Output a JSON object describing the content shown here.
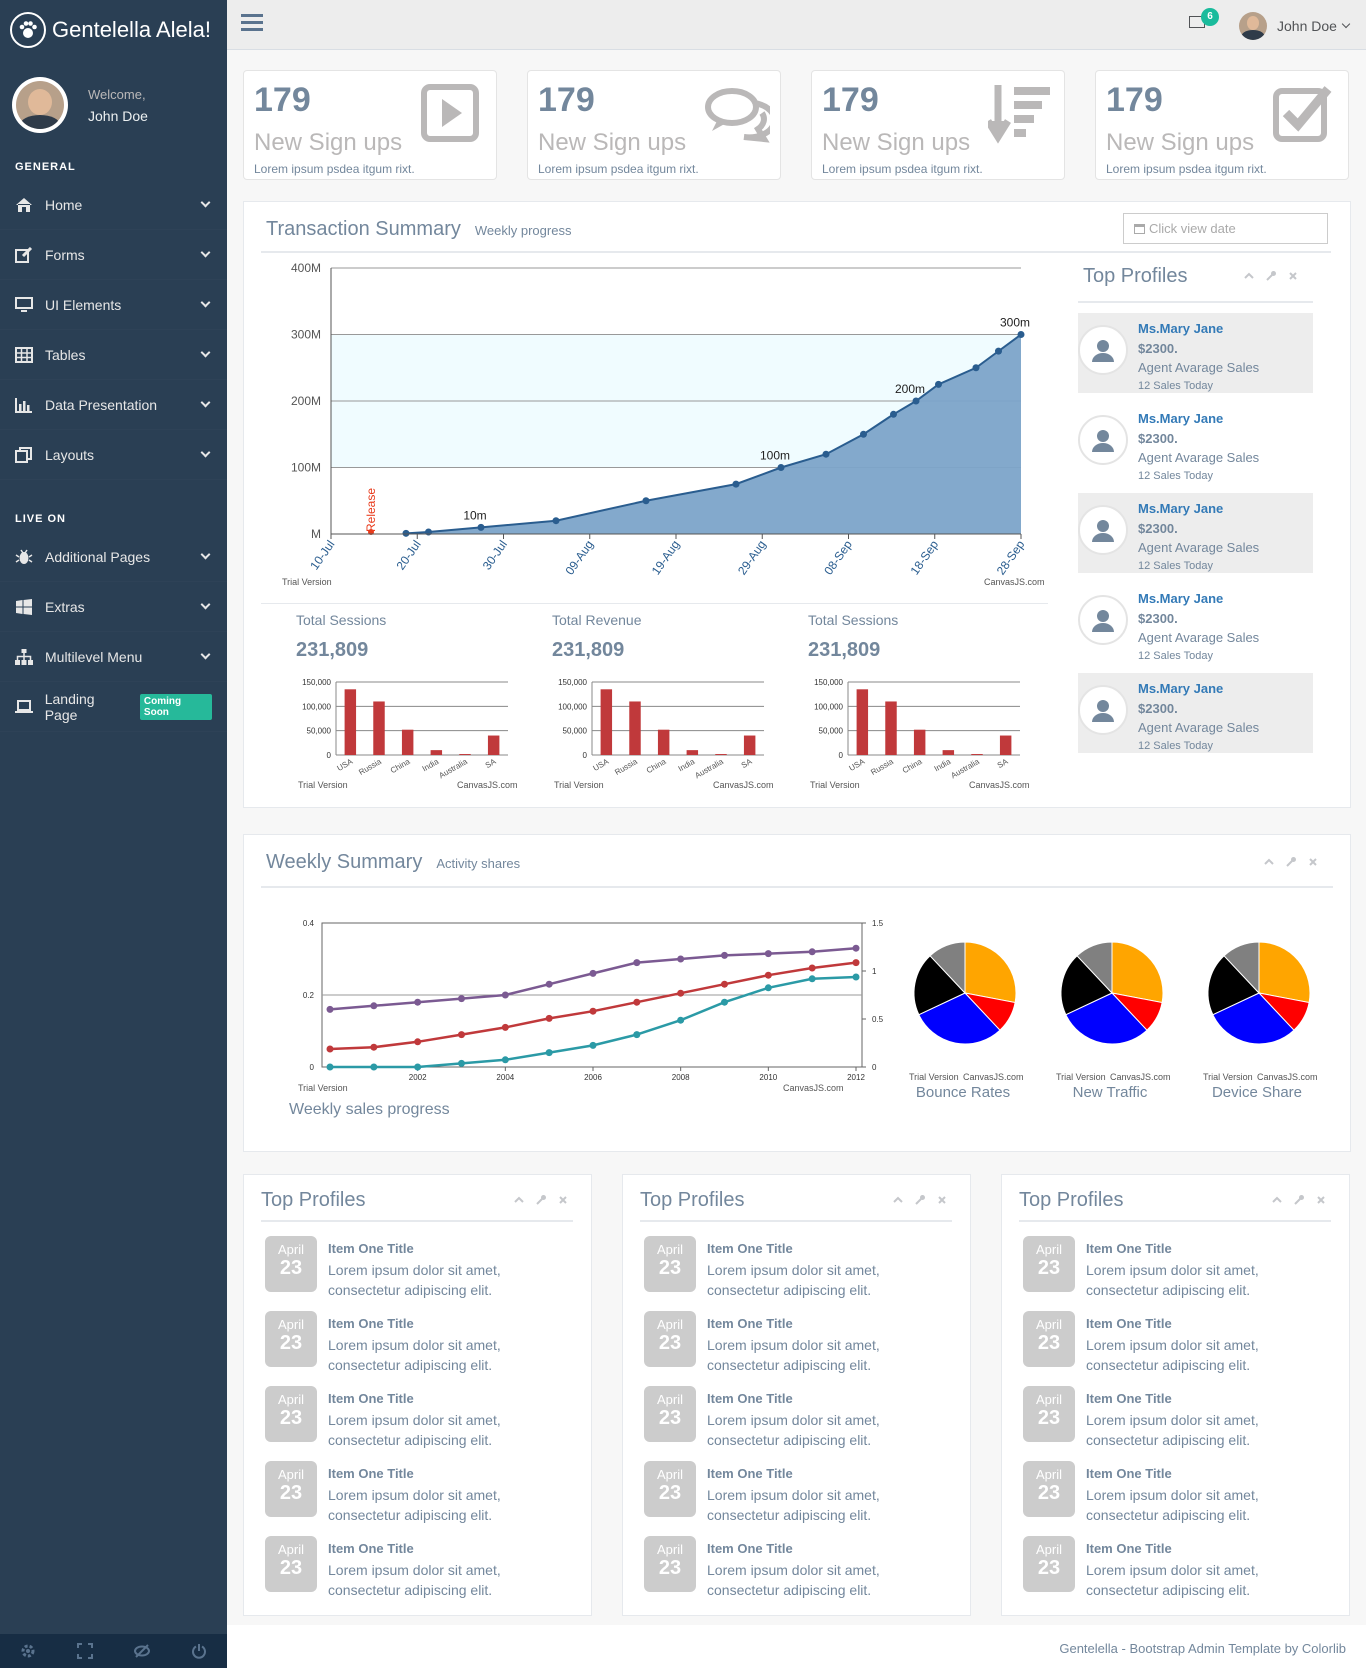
{
  "brand": {
    "title": "Gentelella Alela!"
  },
  "profile": {
    "welcome": "Welcome,",
    "name": "John Doe"
  },
  "sidebar": {
    "general_title": "GENERAL",
    "general_items": [
      {
        "label": "Home",
        "icon": "home-icon"
      },
      {
        "label": "Forms",
        "icon": "edit-icon"
      },
      {
        "label": "UI Elements",
        "icon": "desktop-icon"
      },
      {
        "label": "Tables",
        "icon": "table-icon"
      },
      {
        "label": "Data Presentation",
        "icon": "bar-chart-icon"
      },
      {
        "label": "Layouts",
        "icon": "clone-icon"
      }
    ],
    "live_title": "LIVE ON",
    "live_items": [
      {
        "label": "Additional Pages",
        "icon": "bug-icon"
      },
      {
        "label": "Extras",
        "icon": "windows-icon"
      },
      {
        "label": "Multilevel Menu",
        "icon": "sitemap-icon"
      },
      {
        "label": "Landing Page",
        "icon": "laptop-icon",
        "badge": "Coming Soon"
      }
    ]
  },
  "topnav": {
    "notifications": "6",
    "user": "John Doe"
  },
  "tiles": [
    {
      "count": "179",
      "title": "New Sign ups",
      "text": "Lorem ipsum psdea itgum rixt.",
      "icon": "caret-square-icon"
    },
    {
      "count": "179",
      "title": "New Sign ups",
      "text": "Lorem ipsum psdea itgum rixt.",
      "icon": "comments-icon"
    },
    {
      "count": "179",
      "title": "New Sign ups",
      "text": "Lorem ipsum psdea itgum rixt.",
      "icon": "sort-amount-icon"
    },
    {
      "count": "179",
      "title": "New Sign ups",
      "text": "Lorem ipsum psdea itgum rixt.",
      "icon": "check-square-icon"
    }
  ],
  "transaction": {
    "title": "Transaction Summary",
    "subtitle": "Weekly progress",
    "date_placeholder": "Click view date",
    "trial": "Trial Version",
    "credit": "CanvasJS.com",
    "minis": [
      {
        "title": "Total Sessions",
        "value": "231,809"
      },
      {
        "title": "Total Revenue",
        "value": "231,809"
      },
      {
        "title": "Total Sessions",
        "value": "231,809"
      }
    ]
  },
  "top_profiles_side": {
    "title": "Top Profiles",
    "items": [
      {
        "name": "Ms.Mary Jane",
        "value": "$2300.",
        "desc": "Agent Avarage Sales",
        "sales": "12 Sales Today"
      },
      {
        "name": "Ms.Mary Jane",
        "value": "$2300.",
        "desc": "Agent Avarage Sales",
        "sales": "12 Sales Today"
      },
      {
        "name": "Ms.Mary Jane",
        "value": "$2300.",
        "desc": "Agent Avarage Sales",
        "sales": "12 Sales Today"
      },
      {
        "name": "Ms.Mary Jane",
        "value": "$2300.",
        "desc": "Agent Avarage Sales",
        "sales": "12 Sales Today"
      },
      {
        "name": "Ms.Mary Jane",
        "value": "$2300.",
        "desc": "Agent Avarage Sales",
        "sales": "12 Sales Today"
      }
    ]
  },
  "weekly": {
    "title": "Weekly Summary",
    "subtitle": "Activity shares",
    "caption": "Weekly sales progress",
    "pies": [
      "Bounce Rates",
      "New Traffic",
      "Device Share"
    ]
  },
  "event_panels": [
    {
      "title": "Top Profiles",
      "items": [
        {
          "month": "April",
          "day": "23",
          "title": "Item One Title",
          "text": "Lorem ipsum dolor sit amet, consectetur adipiscing elit."
        },
        {
          "month": "April",
          "day": "23",
          "title": "Item One Title",
          "text": "Lorem ipsum dolor sit amet, consectetur adipiscing elit."
        },
        {
          "month": "April",
          "day": "23",
          "title": "Item One Title",
          "text": "Lorem ipsum dolor sit amet, consectetur adipiscing elit."
        },
        {
          "month": "April",
          "day": "23",
          "title": "Item One Title",
          "text": "Lorem ipsum dolor sit amet, consectetur adipiscing elit."
        },
        {
          "month": "April",
          "day": "23",
          "title": "Item One Title",
          "text": "Lorem ipsum dolor sit amet, consectetur adipiscing elit."
        }
      ]
    },
    {
      "title": "Top Profiles",
      "items": [
        {
          "month": "April",
          "day": "23",
          "title": "Item One Title",
          "text": "Lorem ipsum dolor sit amet, consectetur adipiscing elit."
        },
        {
          "month": "April",
          "day": "23",
          "title": "Item One Title",
          "text": "Lorem ipsum dolor sit amet, consectetur adipiscing elit."
        },
        {
          "month": "April",
          "day": "23",
          "title": "Item One Title",
          "text": "Lorem ipsum dolor sit amet, consectetur adipiscing elit."
        },
        {
          "month": "April",
          "day": "23",
          "title": "Item One Title",
          "text": "Lorem ipsum dolor sit amet, consectetur adipiscing elit."
        },
        {
          "month": "April",
          "day": "23",
          "title": "Item One Title",
          "text": "Lorem ipsum dolor sit amet, consectetur adipiscing elit."
        }
      ]
    },
    {
      "title": "Top Profiles",
      "items": [
        {
          "month": "April",
          "day": "23",
          "title": "Item One Title",
          "text": "Lorem ipsum dolor sit amet, consectetur adipiscing elit."
        },
        {
          "month": "April",
          "day": "23",
          "title": "Item One Title",
          "text": "Lorem ipsum dolor sit amet, consectetur adipiscing elit."
        },
        {
          "month": "April",
          "day": "23",
          "title": "Item One Title",
          "text": "Lorem ipsum dolor sit amet, consectetur adipiscing elit."
        },
        {
          "month": "April",
          "day": "23",
          "title": "Item One Title",
          "text": "Lorem ipsum dolor sit amet, consectetur adipiscing elit."
        },
        {
          "month": "April",
          "day": "23",
          "title": "Item One Title",
          "text": "Lorem ipsum dolor sit amet, consectetur adipiscing elit."
        }
      ]
    }
  ],
  "footer": {
    "text": "Gentelella - Bootstrap Admin Template by Colorlib"
  },
  "colors": {
    "sidebar": "#2a3f54",
    "accent": "#1abb9c",
    "area": "#7ca4c9",
    "bar": "#c0393b"
  },
  "chart_data": [
    {
      "type": "area",
      "x": [
        "10-Jul",
        "20-Jul",
        "30-Jul",
        "09-Aug",
        "19-Aug",
        "29-Aug",
        "08-Sep",
        "18-Sep",
        "28-Sep"
      ],
      "points": [
        {
          "x": "2015-07-20",
          "y": 1
        },
        {
          "x": "2015-07-23",
          "y": 3
        },
        {
          "x": "2015-07-30",
          "y": 10
        },
        {
          "x": "2015-08-09",
          "y": 20
        },
        {
          "x": "2015-08-21",
          "y": 50
        },
        {
          "x": "2015-09-02",
          "y": 75
        },
        {
          "x": "2015-09-08",
          "y": 100
        },
        {
          "x": "2015-09-14",
          "y": 120
        },
        {
          "x": "2015-09-19",
          "y": 150
        },
        {
          "x": "2015-09-23",
          "y": 180
        },
        {
          "x": "2015-09-26",
          "y": 200
        },
        {
          "x": "2015-09-29",
          "y": 225
        },
        {
          "x": "2015-10-04",
          "y": 250
        },
        {
          "x": "2015-10-07",
          "y": 275
        },
        {
          "x": "2015-10-10",
          "y": 300
        }
      ],
      "point_labels": [
        {
          "x": "2015-07-30",
          "text": "10m"
        },
        {
          "x": "2015-09-08",
          "text": "100m"
        },
        {
          "x": "2015-09-26",
          "text": "200m"
        },
        {
          "x": "2015-10-10",
          "text": "300m"
        }
      ],
      "y_ticks": [
        "M",
        "100M",
        "200M",
        "300M",
        "400M"
      ],
      "ylim": [
        0,
        400
      ],
      "band": [
        100,
        300
      ],
      "release_label": "Release"
    },
    {
      "type": "bar",
      "categories": [
        "USA",
        "Russia",
        "China",
        "India",
        "Australia",
        "SA"
      ],
      "values": [
        135000,
        110000,
        52000,
        10000,
        2000,
        40000
      ],
      "y_ticks": [
        "150,000",
        "100,000",
        "50,000",
        "0"
      ],
      "ylim": [
        0,
        150000
      ]
    },
    {
      "type": "line",
      "x": [
        2000,
        2001,
        2002,
        2003,
        2004,
        2005,
        2006,
        2007,
        2008,
        2009,
        2010,
        2011,
        2012
      ],
      "x_ticks": [
        "2002",
        "2004",
        "2006",
        "2008",
        "2010",
        "2012"
      ],
      "y_ticks_left": [
        "0.4",
        "0.2",
        "0"
      ],
      "y_ticks_right": [
        "1.5",
        "1",
        "0.5",
        "0"
      ],
      "series": [
        {
          "color": "#7b5a92",
          "values": [
            0.16,
            0.17,
            0.18,
            0.19,
            0.2,
            0.23,
            0.26,
            0.29,
            0.3,
            0.31,
            0.315,
            0.32,
            0.33
          ]
        },
        {
          "color": "#c0393b",
          "values": [
            0.05,
            0.055,
            0.07,
            0.09,
            0.11,
            0.135,
            0.155,
            0.18,
            0.205,
            0.23,
            0.255,
            0.275,
            0.29
          ]
        },
        {
          "color": "#2b9aa6",
          "values": [
            0.0,
            0.0,
            0.0,
            0.01,
            0.02,
            0.04,
            0.06,
            0.09,
            0.13,
            0.18,
            0.22,
            0.245,
            0.25
          ]
        }
      ]
    },
    {
      "type": "pie",
      "slices": [
        {
          "color": "#ffa500",
          "value": 28
        },
        {
          "color": "#ff0000",
          "value": 10
        },
        {
          "color": "#0000ff",
          "value": 30
        },
        {
          "color": "#000000",
          "value": 20
        },
        {
          "color": "#808080",
          "value": 12
        }
      ]
    }
  ]
}
